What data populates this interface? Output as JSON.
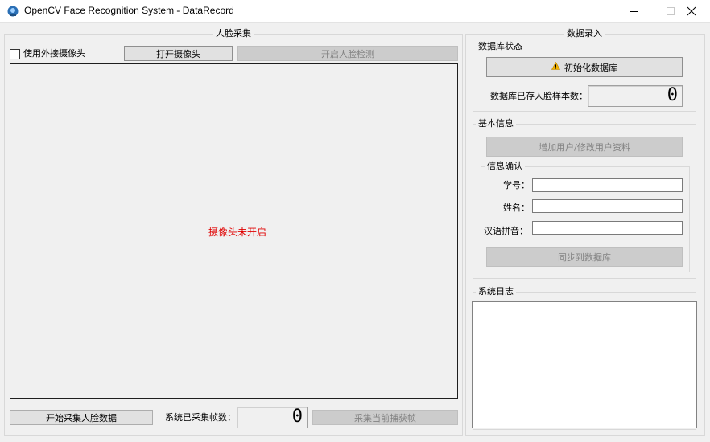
{
  "window": {
    "title": "OpenCV Face Recognition System - DataRecord",
    "minimize_glyph": "—",
    "maximize_glyph": "□",
    "close_glyph": "✕"
  },
  "capture": {
    "group_title": "人脸采集",
    "external_camera_label": "使用外接摄像头",
    "external_camera_checked": false,
    "open_camera_label": "打开摄像头",
    "face_detect_label": "开启人脸检测",
    "camera_status": "摄像头未开启",
    "start_capture_label": "开始采集人脸数据",
    "frames_captured_label": "系统已采集帧数：",
    "frames_captured_value": "0",
    "capture_frame_label": "采集当前捕获帧"
  },
  "entry": {
    "group_title": "数据录入",
    "db_status": {
      "title": "数据库状态",
      "init_db_label": "初始化数据库",
      "warning_icon": "warning-icon",
      "samples_label": "数据库已存人脸样本数：",
      "samples_value": "0"
    },
    "basic_info": {
      "title": "基本信息",
      "add_user_label": "增加用户/修改用户资料",
      "confirm_title": "信息确认",
      "student_id_label": "学号：",
      "student_id_value": "",
      "name_label": "姓名：",
      "name_value": "",
      "pinyin_label": "汉语拼音：",
      "pinyin_value": "",
      "sync_label": "同步到数据库"
    },
    "log": {
      "title": "系统日志",
      "content": ""
    }
  },
  "colors": {
    "status_red": "#e00000",
    "warning_yellow": "#f4b400"
  }
}
